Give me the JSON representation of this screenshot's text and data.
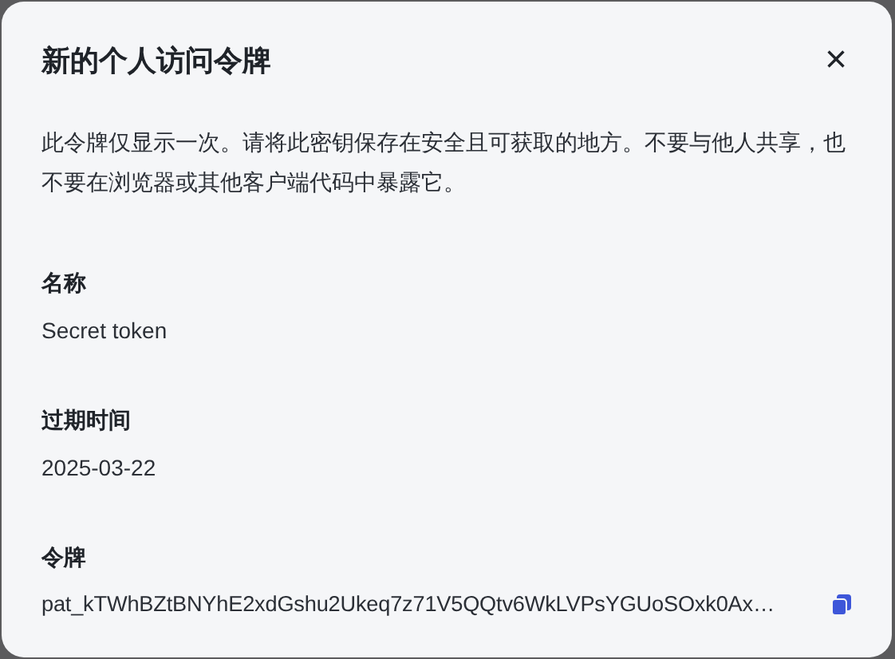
{
  "dialog": {
    "title": "新的个人访问令牌",
    "close": "×",
    "description": "此令牌仅显示一次。请将此密钥保存在安全且可获取的地方。不要与他人共享，也不要在浏览器或其他客户端代码中暴露它。",
    "fields": [
      {
        "label": "名称",
        "value": "Secret token",
        "kind": "text"
      },
      {
        "label": "过期时间",
        "value": "2025-03-22",
        "kind": "text"
      },
      {
        "label": "令牌",
        "value": "pat_kTWhBZtBNYhE2xdGshu2Ukeq7z71V5QQtv6WkLVPsYGUoSOxk0Ax…",
        "kind": "copy"
      }
    ]
  }
}
